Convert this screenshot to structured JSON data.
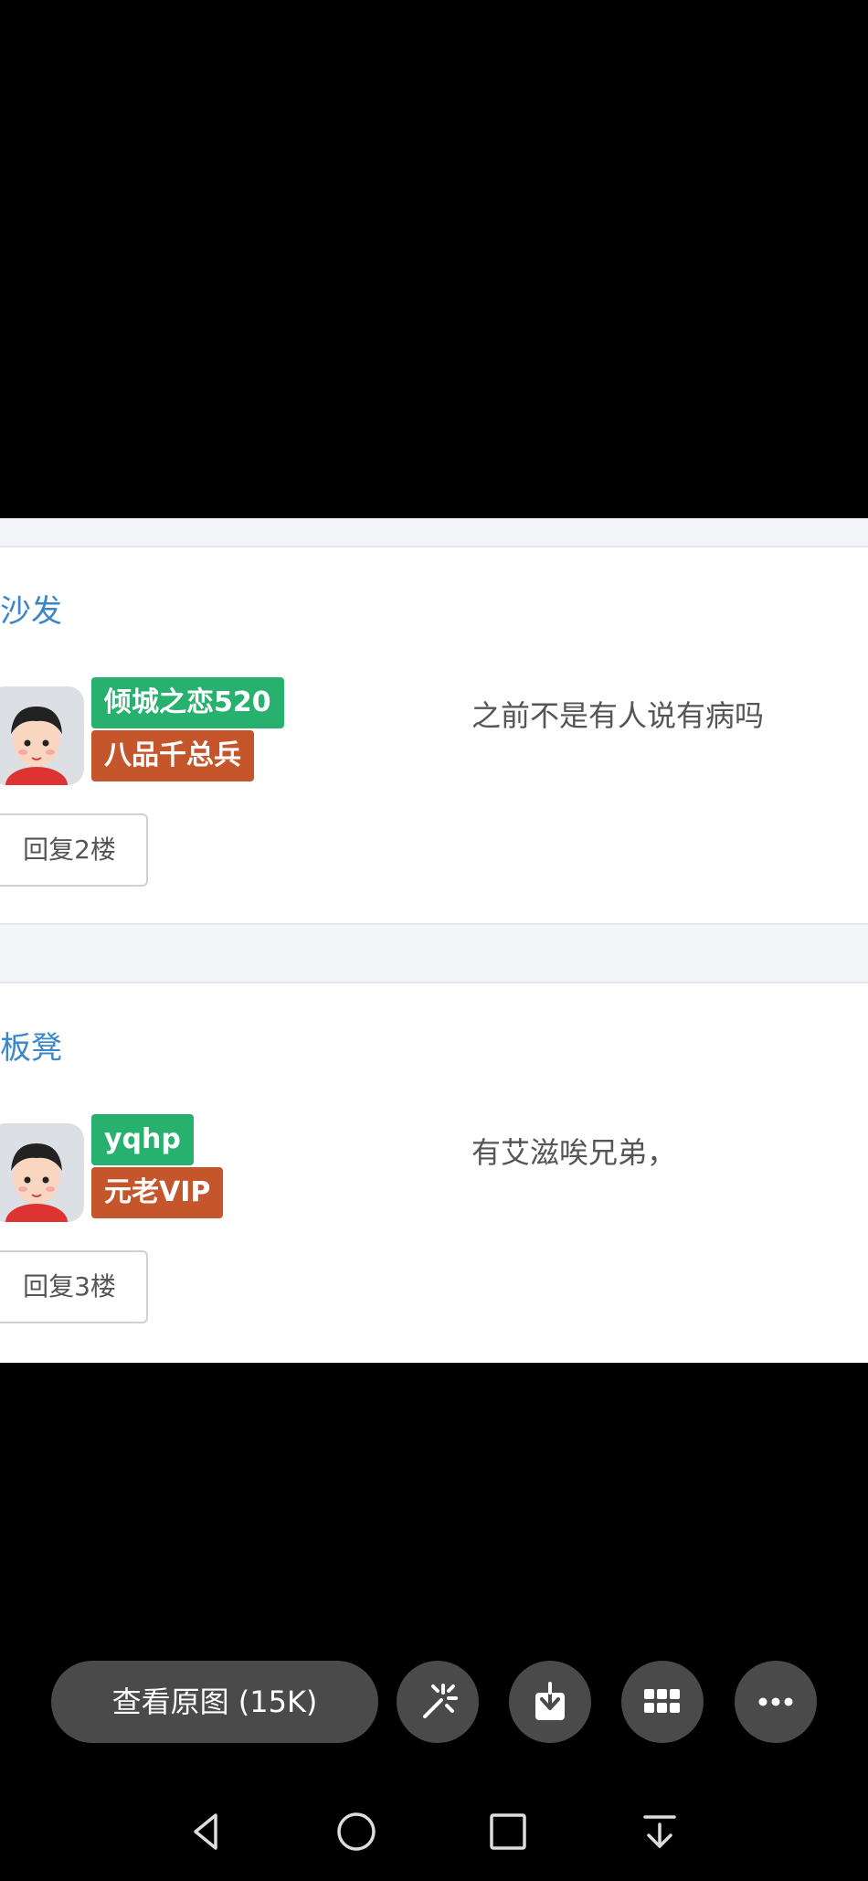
{
  "posts": [
    {
      "floor_tag": "沙发",
      "username": "倾城之恋520",
      "rank": "八品千总兵",
      "content": "之前不是有人说有病吗",
      "reply_label": "回复2楼"
    },
    {
      "floor_tag": "板凳",
      "username": "yqhp",
      "rank": "元老VIP",
      "content": "有艾滋唉兄弟，",
      "reply_label": "回复3楼"
    }
  ],
  "viewer": {
    "view_original_label": "查看原图 (15K)",
    "actions": [
      {
        "icon": "magic-wand-icon"
      },
      {
        "icon": "download-icon"
      },
      {
        "icon": "grid-icon"
      },
      {
        "icon": "more-icon"
      }
    ]
  },
  "system_nav": {
    "buttons": [
      "back-icon",
      "home-icon",
      "recents-icon",
      "notification-pull-icon"
    ]
  },
  "colors": {
    "link_blue": "#3a86c8",
    "badge_green": "#27b06e",
    "badge_orange": "#c5552a",
    "toolbar_button": "#4a4a4a"
  }
}
